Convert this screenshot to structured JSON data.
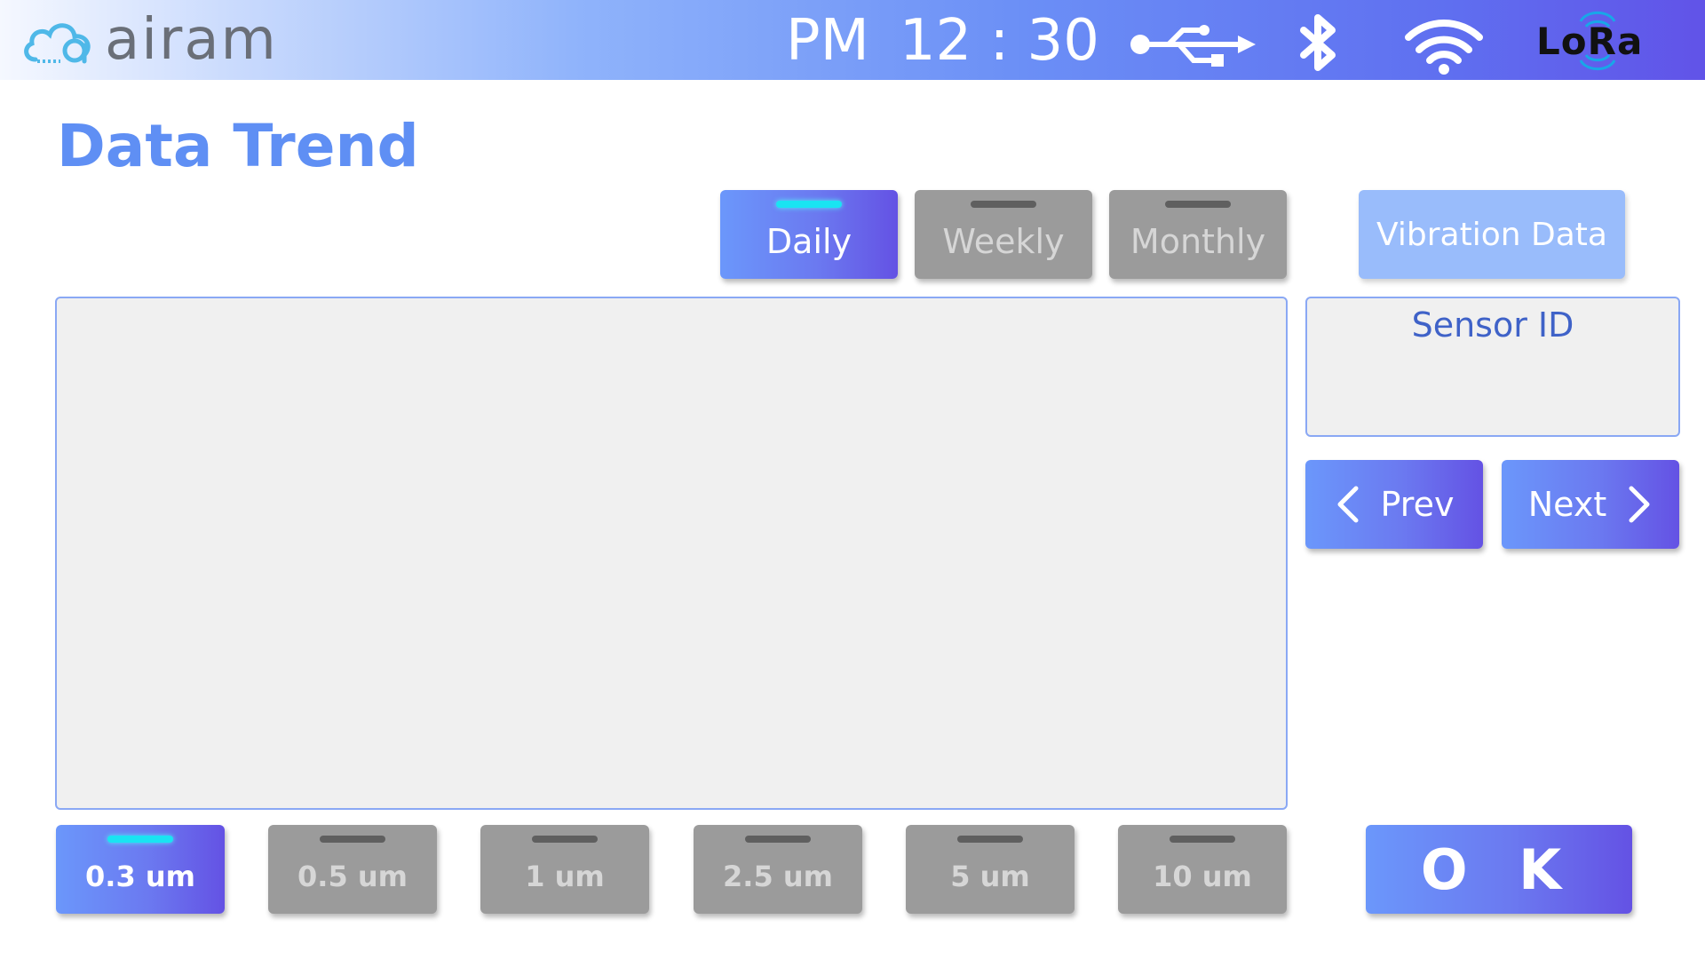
{
  "header": {
    "logo_text": "airam",
    "clock": {
      "ampm": "PM",
      "time": "12 : 30"
    },
    "status_icons": [
      "usb-icon",
      "bluetooth-icon",
      "wifi-icon",
      "lora-icon"
    ],
    "lora_text": "LoRa"
  },
  "page": {
    "title": "Data Trend"
  },
  "period_tabs": [
    {
      "label": "Daily",
      "active": true
    },
    {
      "label": "Weekly",
      "active": false
    },
    {
      "label": "Monthly",
      "active": false
    }
  ],
  "vibration_button": {
    "label": "Vibration Data"
  },
  "sensor": {
    "label": "Sensor ID",
    "value": ""
  },
  "nav": {
    "prev_label": "Prev",
    "next_label": "Next"
  },
  "particle_sizes": [
    {
      "label": "0.3 um",
      "active": true
    },
    {
      "label": "0.5 um",
      "active": false
    },
    {
      "label": "1 um",
      "active": false
    },
    {
      "label": "2.5 um",
      "active": false
    },
    {
      "label": "5 um",
      "active": false
    },
    {
      "label": "10 um",
      "active": false
    }
  ],
  "ok_button": {
    "label": "O K"
  },
  "colors": {
    "accent": "#5f8ff4",
    "active_indicator": "#19e4f2",
    "inactive_button": "#9b9b9b",
    "header_gradient_end": "#6153e8"
  }
}
